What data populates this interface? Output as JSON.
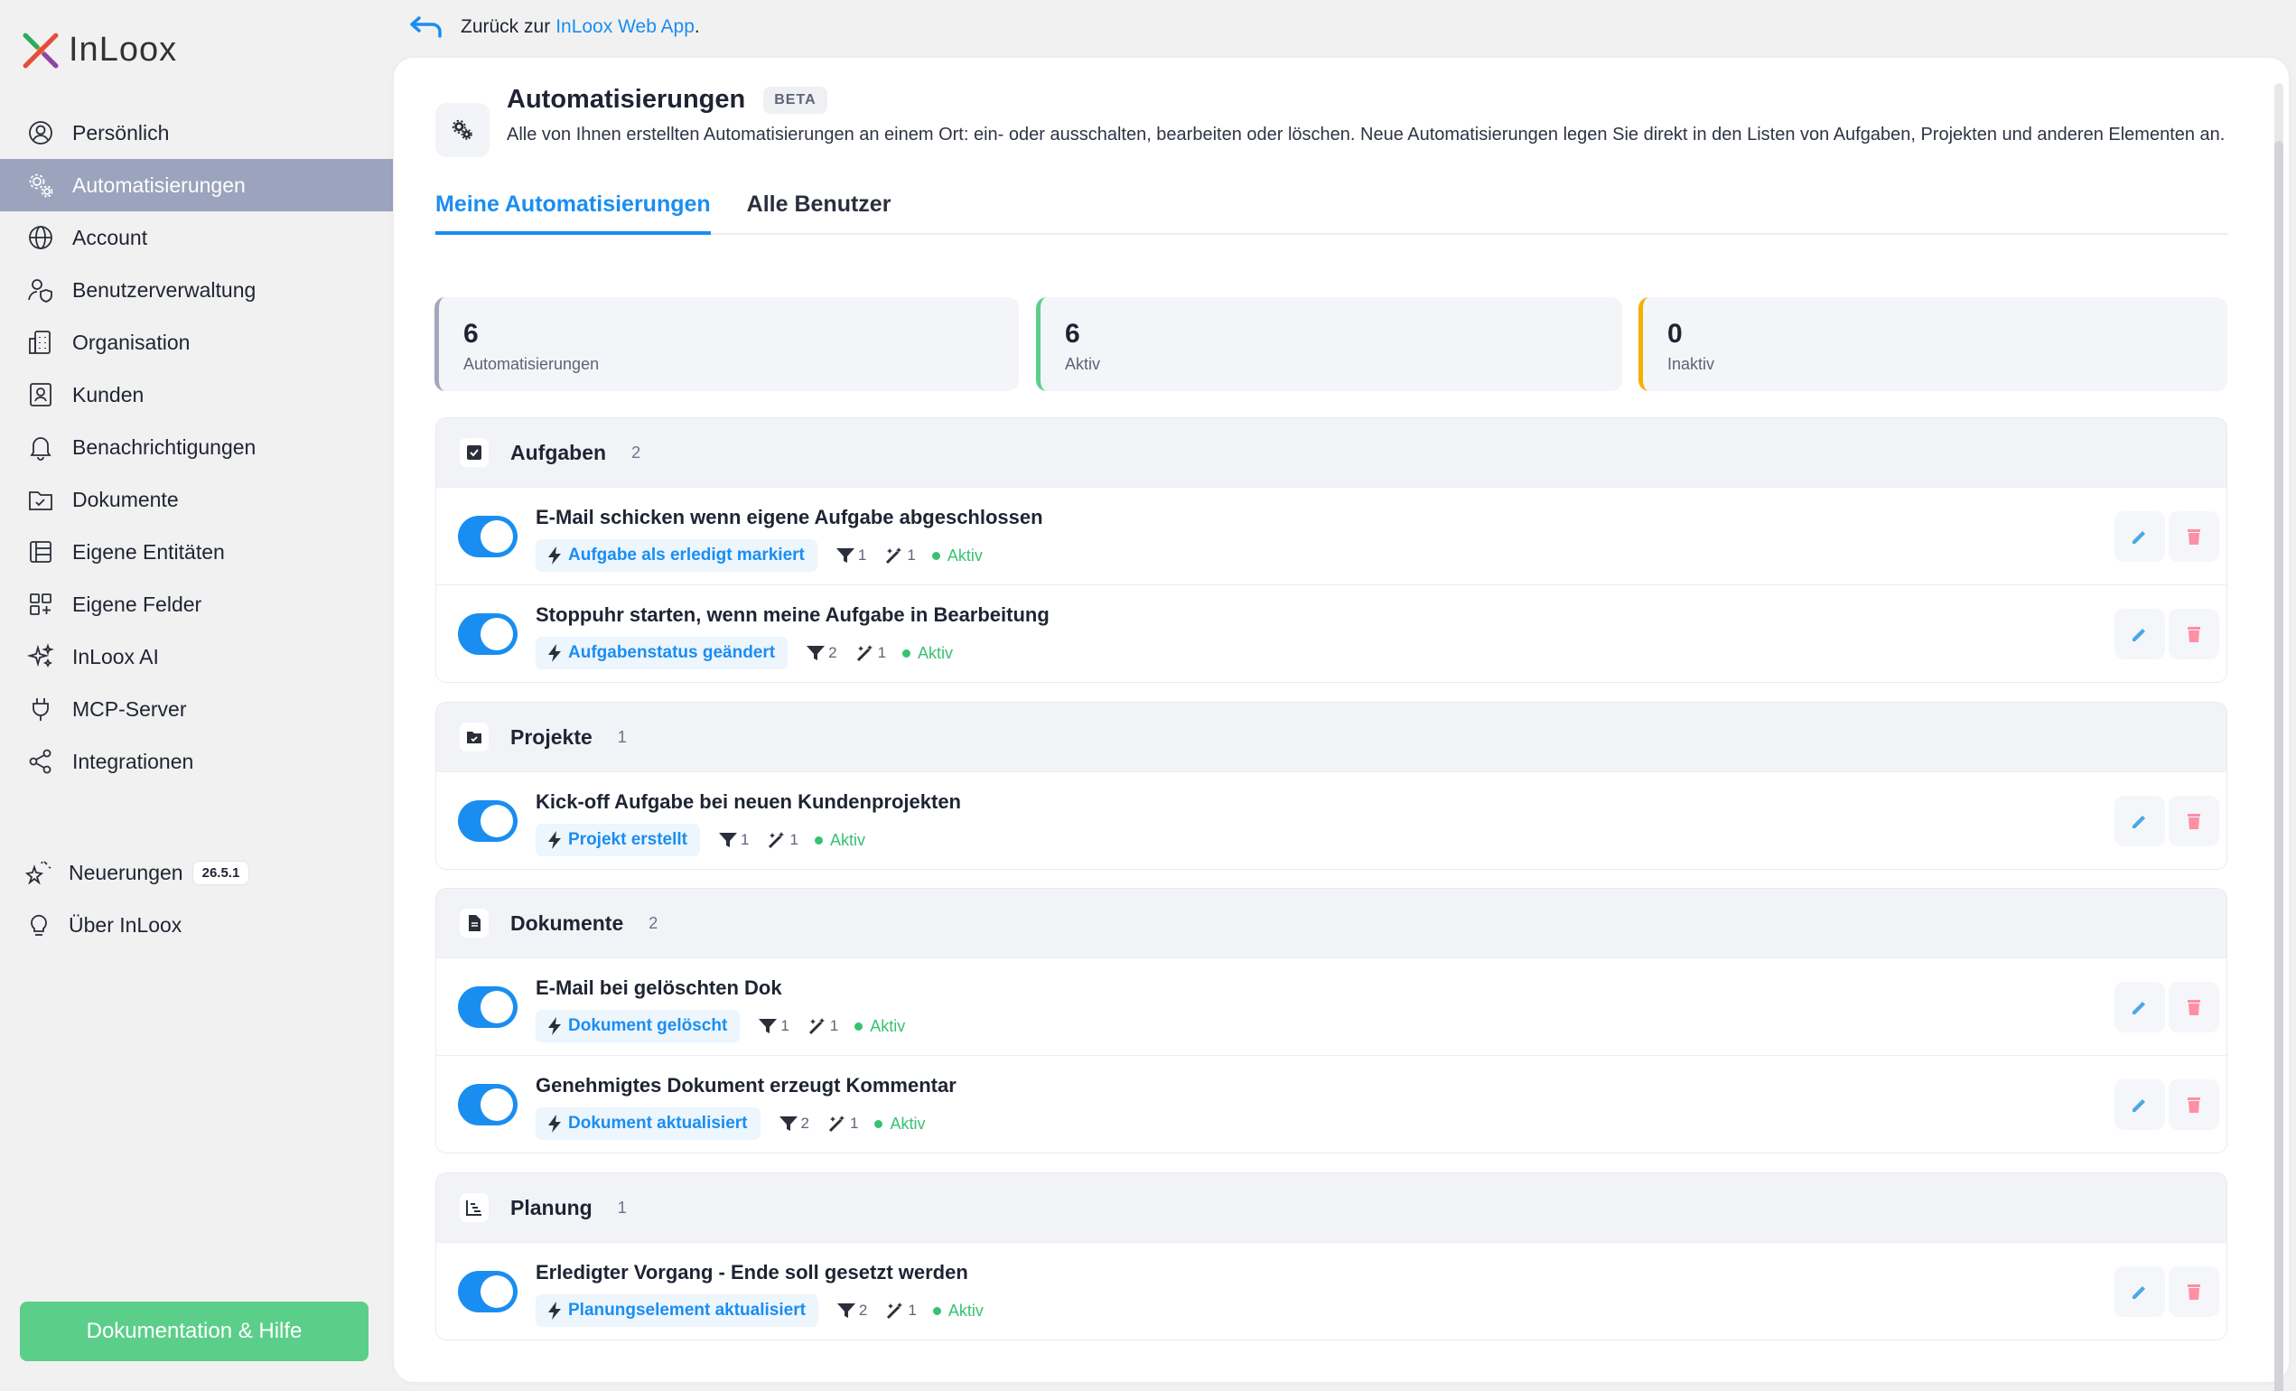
{
  "brand": {
    "name": "InLoox"
  },
  "back": {
    "prefix": "Zurück zur ",
    "link": "InLoox Web App",
    "suffix": "."
  },
  "sidebar": {
    "items": [
      {
        "label": "Persönlich",
        "icon": "user-circle-icon"
      },
      {
        "label": "Automatisierungen",
        "icon": "gears-icon",
        "active": true
      },
      {
        "label": "Account",
        "icon": "globe-icon"
      },
      {
        "label": "Benutzerverwaltung",
        "icon": "user-shield-icon"
      },
      {
        "label": "Organisation",
        "icon": "building-icon"
      },
      {
        "label": "Kunden",
        "icon": "contact-card-icon"
      },
      {
        "label": "Benachrichtigungen",
        "icon": "bell-icon"
      },
      {
        "label": "Dokumente",
        "icon": "folder-check-icon"
      },
      {
        "label": "Eigene Entitäten",
        "icon": "table-icon"
      },
      {
        "label": "Eigene Felder",
        "icon": "grid-plus-icon"
      },
      {
        "label": "InLoox AI",
        "icon": "sparkles-icon"
      },
      {
        "label": "MCP-Server",
        "icon": "plug-icon"
      },
      {
        "label": "Integrationen",
        "icon": "share-nodes-icon"
      }
    ],
    "secondary": [
      {
        "label": "Neuerungen",
        "badge": "26.5.1",
        "icon": "stars-icon"
      },
      {
        "label": "Über InLoox",
        "icon": "lightbulb-icon"
      }
    ],
    "help_button": "Dokumentation & Hilfe"
  },
  "page": {
    "title": "Automatisierungen",
    "badge": "BETA",
    "description": "Alle von Ihnen erstellten Automatisierungen an einem Ort: ein- oder ausschalten, bearbeiten oder löschen. Neue Automatisierungen legen Sie direkt in den Listen von Aufgaben, Projekten und anderen Elementen an.",
    "tabs": [
      {
        "label": "Meine Automatisierungen",
        "active": true
      },
      {
        "label": "Alle Benutzer",
        "active": false
      }
    ]
  },
  "stats": [
    {
      "value": "6",
      "label": "Automatisierungen",
      "color": "#a3a9bb"
    },
    {
      "value": "6",
      "label": "Aktiv",
      "color": "#5bcf8a"
    },
    {
      "value": "0",
      "label": "Inaktiv",
      "color": "#f5b000"
    }
  ],
  "groups": [
    {
      "title": "Aufgaben",
      "count": "2",
      "icon": "checkbox-icon",
      "rows": [
        {
          "title": "E-Mail schicken wenn eigene Aufgabe abgeschlossen",
          "trigger": "Aufgabe als erledigt markiert",
          "filters": "1",
          "actions": "1",
          "status": "Aktiv"
        },
        {
          "title": "Stoppuhr starten, wenn meine Aufgabe in Bearbeitung",
          "trigger": "Aufgabenstatus geändert",
          "filters": "2",
          "actions": "1",
          "status": "Aktiv"
        }
      ]
    },
    {
      "title": "Projekte",
      "count": "1",
      "icon": "project-folder-icon",
      "rows": [
        {
          "title": "Kick-off Aufgabe bei neuen Kundenprojekten",
          "trigger": "Projekt erstellt",
          "filters": "1",
          "actions": "1",
          "status": "Aktiv"
        }
      ]
    },
    {
      "title": "Dokumente",
      "count": "2",
      "icon": "document-icon",
      "rows": [
        {
          "title": "E-Mail bei gelöschten Dok",
          "trigger": "Dokument gelöscht",
          "filters": "1",
          "actions": "1",
          "status": "Aktiv"
        },
        {
          "title": "Genehmigtes Dokument erzeugt Kommentar",
          "trigger": "Dokument aktualisiert",
          "filters": "2",
          "actions": "1",
          "status": "Aktiv"
        }
      ]
    },
    {
      "title": "Planung",
      "count": "1",
      "icon": "gantt-icon",
      "rows": [
        {
          "title": "Erledigter Vorgang - Ende soll gesetzt werden",
          "trigger": "Planungselement aktualisiert",
          "filters": "2",
          "actions": "1",
          "status": "Aktiv"
        }
      ]
    }
  ],
  "colors": {
    "accent": "#1a8ef0",
    "success": "#38c172",
    "danger": "#ff8fa3",
    "active_nav": "#9ba3bd"
  }
}
